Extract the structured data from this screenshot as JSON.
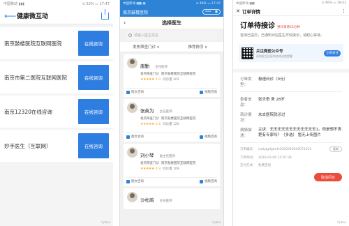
{
  "screen1": {
    "status_left": "中国移动 ▮▮▮",
    "status_right": "⊙ 52% ▭ 17:47",
    "title": "健康微互动",
    "rows": [
      {
        "name": "南京鼓楼医院互联网医院",
        "button": "在线咨询"
      },
      {
        "name": "南京市第二医院互联网医院",
        "button": "在线咨询"
      },
      {
        "name": "南京12320在线咨询",
        "button": "在线咨询"
      },
      {
        "name": "妙手医生（互联网）",
        "button": "在线咨询"
      }
    ],
    "float_label": "Upbox"
  },
  "screen2": {
    "status_left": "中国移动 ▮▮▮ ▣",
    "status_right": "⊙ 48% ▭ 17:47",
    "hospital": "南京鼓楼医院",
    "pill_left": "•••",
    "pill_right": "◉",
    "title": "选择医生",
    "search_placeholder": "请输入医生姓名",
    "filter_left": "发热筛查门诊",
    "filter_right": "推荐排序",
    "doctors": [
      {
        "name": "唐勤",
        "title": "主任医师",
        "dept": "发热筛查门诊",
        "hospital": "南京鼓楼医院互联网医院",
        "stars": "★★★★★",
        "score": "4.9",
        "count_label": "问诊量 202",
        "action": "图文咨询"
      },
      {
        "name": "张英为",
        "title": "主任医师",
        "dept": "发热筛查门诊",
        "hospital": "南京鼓楼医院互联网医院",
        "stars": "★★★★★",
        "score": "4.6",
        "count_label": "问诊量 120",
        "action": "图文咨询"
      },
      {
        "name": "刘小琴",
        "title": "副主任医师",
        "dept": "发热筛查门诊",
        "hospital": "南京鼓楼医院互联网医院",
        "stars": "★★★★★",
        "score": "4.9",
        "count_label": "问诊量 109",
        "action": "图文咨询"
      },
      {
        "name": "沙杜鹃",
        "title": "主任医师"
      }
    ],
    "video_action": "视频咨询",
    "float_label": "Upbox"
  },
  "screen3": {
    "status_left": "中国移动 ▮▮▮",
    "status_right": "⊙ 46% ▭ 18:41",
    "close": "✕",
    "title": "订单详情",
    "dots": "⋮",
    "heading": "订单待接诊",
    "heading_note": "预计等待23分钟",
    "notice": "咨询已提交，已通知对应医生尽快接诊，请耐心等待。",
    "follow_title": "关注微医公众号",
    "follow_sub": "获取医生回复和咨询进度提醒",
    "follow_button": "立即关注",
    "order_type_key": "订单类型：",
    "order_type_val": "极速问诊（0元）",
    "patient_key": "患者信息：",
    "patient_val": "张天奇 男 28岁",
    "hospital_key": "就诊情况：",
    "hospital_val": "未去医院就诊过",
    "desc_key": "病情描述：",
    "desc_val": "主诉：无无无无无无无无无无无无1。但是想不清楚有专家吗？（多选） 暂无上传图片",
    "order_no_key": "订单编号：",
    "order_no_val": "rjwkjqpfgbnfz2020020945071012",
    "copy_label": "复制",
    "time_key": "下单时间：",
    "time_val": "2020-02-09 15:07:36",
    "pay_key": "支付方式：",
    "pay_val": "免费咨询",
    "cancel_label": "取消问诊",
    "float_label": "Upbox"
  }
}
